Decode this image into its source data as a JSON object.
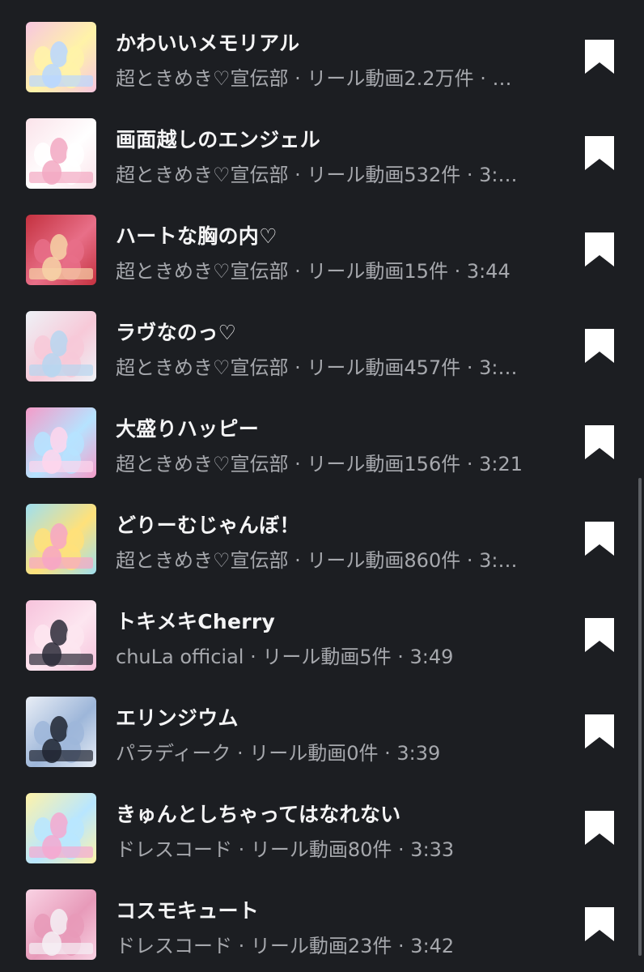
{
  "songs": [
    {
      "title": "かわいいメモリアル",
      "meta": "超ときめき♡宣伝部 · リール動画2.2万件 · …",
      "thumb_colors": [
        "#f7c6e0",
        "#b9d7ff",
        "#fff3a8"
      ]
    },
    {
      "title": "画面越しのエンジェル",
      "meta": "超ときめき♡宣伝部 · リール動画532件 · 3:…",
      "thumb_colors": [
        "#fbe3ea",
        "#f2a8c2",
        "#ffffff"
      ]
    },
    {
      "title": "ハートな胸の内♡",
      "meta": "超ときめき♡宣伝部 · リール動画15件 · 3:44",
      "thumb_colors": [
        "#c4313f",
        "#f6d3a6",
        "#e86f88"
      ]
    },
    {
      "title": "ラヴなのっ♡",
      "meta": "超ときめき♡宣伝部 · リール動画457件 · 3:…",
      "thumb_colors": [
        "#eef2f7",
        "#b7d6f0",
        "#f7c9d8"
      ]
    },
    {
      "title": "大盛りハッピー",
      "meta": "超ときめき♡宣伝部 · リール動画156件 · 3:21",
      "thumb_colors": [
        "#f59bc8",
        "#ffd6ec",
        "#b6e3ff"
      ]
    },
    {
      "title": "どりーむじゃんぼ！",
      "meta": "超ときめき♡宣伝部 · リール動画860件 · 3:…",
      "thumb_colors": [
        "#9edff0",
        "#f7a5c6",
        "#ffe17a"
      ]
    },
    {
      "title": "トキメキCherry",
      "meta": "chuLa official · リール動画5件 · 3:49",
      "thumb_colors": [
        "#f7c3dc",
        "#2b2b38",
        "#fde6f0"
      ]
    },
    {
      "title": "エリンジウム",
      "meta": "パラディーク · リール動画0件 · 3:39",
      "thumb_colors": [
        "#e9eef6",
        "#1f2430",
        "#9db6d9"
      ]
    },
    {
      "title": "きゅんとしちゃってはなれない",
      "meta": "ドレスコード · リール動画80件 · 3:33",
      "thumb_colors": [
        "#fff3a8",
        "#f5a8d0",
        "#b8e6ff"
      ]
    },
    {
      "title": "コスモキュート",
      "meta": "ドレスコード · リール動画23件 · 3:42",
      "thumb_colors": [
        "#f9d3e4",
        "#f5f0f5",
        "#e79ab9"
      ]
    }
  ],
  "icons": {
    "bookmark": "bookmark-icon"
  },
  "colors": {
    "background": "#1c1e22",
    "title": "#f4f4f5",
    "meta": "#a6a8ad",
    "bookmark": "#ffffff"
  }
}
